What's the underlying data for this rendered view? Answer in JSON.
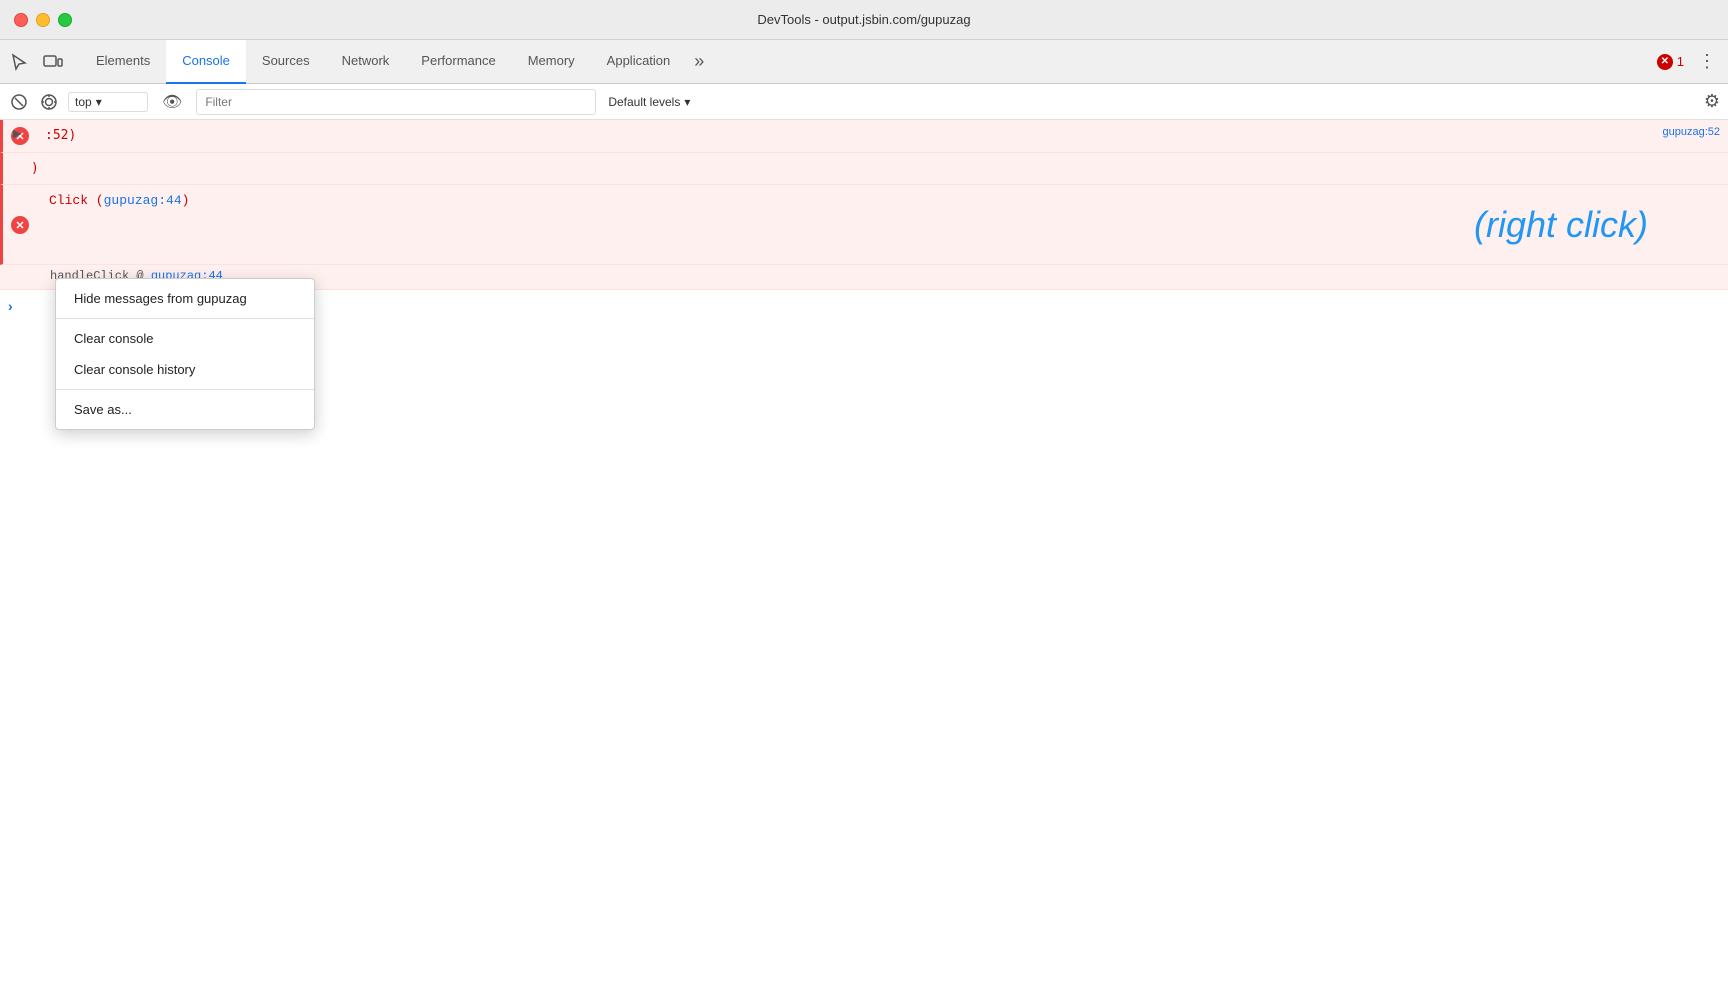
{
  "titlebar": {
    "title": "DevTools - output.jsbin.com/gupuzag"
  },
  "tabs": [
    {
      "id": "elements",
      "label": "Elements",
      "active": false
    },
    {
      "id": "console",
      "label": "Console",
      "active": true
    },
    {
      "id": "sources",
      "label": "Sources",
      "active": false
    },
    {
      "id": "network",
      "label": "Network",
      "active": false
    },
    {
      "id": "performance",
      "label": "Performance",
      "active": false
    },
    {
      "id": "memory",
      "label": "Memory",
      "active": false
    },
    {
      "id": "application",
      "label": "Application",
      "active": false
    }
  ],
  "toolbar": {
    "context": "top",
    "context_arrow": "▾",
    "filter_placeholder": "Filter",
    "default_levels": "Default levels",
    "default_levels_arrow": "▾"
  },
  "error_badge": {
    "count": "1"
  },
  "console_rows": [
    {
      "type": "error",
      "content": ":52)",
      "source": "gupuzag:52"
    },
    {
      "type": "error_continued",
      "content": ")"
    },
    {
      "type": "click_error",
      "click_text": "Click",
      "source_ref": "gupuzag:44",
      "annotation": "(right click)"
    },
    {
      "type": "stack",
      "func": "handleClick",
      "at": "@",
      "source": "gupuzag:44"
    }
  ],
  "context_menu": {
    "items": [
      {
        "id": "hide-messages",
        "label": "Hide messages from gupuzag",
        "separator_after": false
      },
      {
        "id": "clear-console",
        "label": "Clear console",
        "separator_after": false
      },
      {
        "id": "clear-console-history",
        "label": "Clear console history",
        "separator_after": true
      },
      {
        "id": "save-as",
        "label": "Save as...",
        "separator_after": false
      }
    ]
  },
  "prompt": {
    "arrow": "›"
  }
}
